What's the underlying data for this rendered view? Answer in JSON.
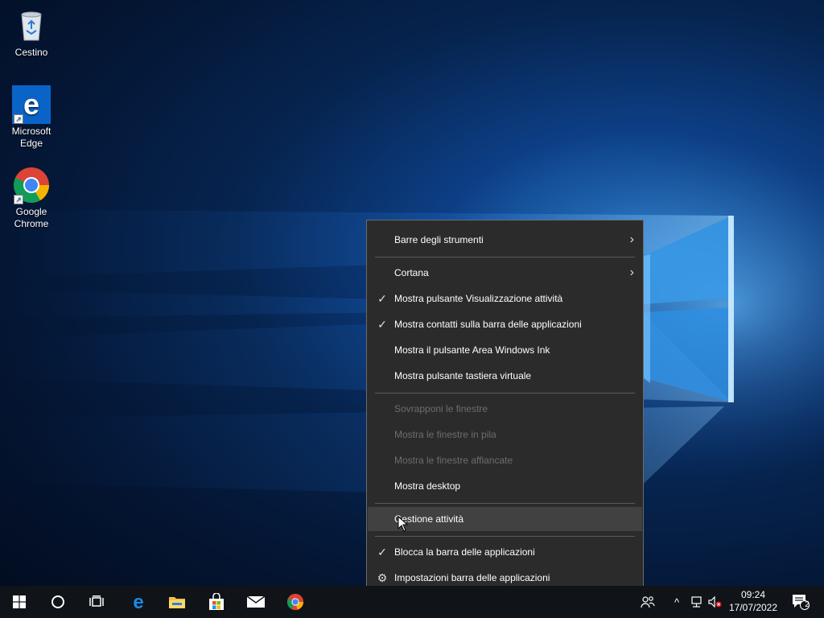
{
  "desktop": {
    "icons": [
      {
        "label_line1": "Cestino",
        "label_line2": ""
      },
      {
        "label_line1": "Microsoft",
        "label_line2": "Edge"
      },
      {
        "label_line1": "Google",
        "label_line2": "Chrome"
      }
    ]
  },
  "context_menu": {
    "items": [
      {
        "label": "Barre degli strumenti",
        "submenu": true,
        "checked": false,
        "disabled": false
      },
      {
        "label": "Cortana",
        "submenu": true,
        "checked": false,
        "disabled": false
      },
      {
        "label": "Mostra pulsante Visualizzazione attività",
        "checked": true,
        "disabled": false
      },
      {
        "label": "Mostra contatti sulla barra delle applicazioni",
        "checked": true,
        "disabled": false
      },
      {
        "label": "Mostra il pulsante Area Windows Ink",
        "checked": false,
        "disabled": false
      },
      {
        "label": "Mostra pulsante tastiera virtuale",
        "checked": false,
        "disabled": false
      },
      {
        "label": "Sovrapponi le finestre",
        "checked": false,
        "disabled": true
      },
      {
        "label": "Mostra le finestre in pila",
        "checked": false,
        "disabled": true
      },
      {
        "label": "Mostra le finestre affiancate",
        "checked": false,
        "disabled": true
      },
      {
        "label": "Mostra desktop",
        "checked": false,
        "disabled": false
      },
      {
        "label": "Gestione attività",
        "checked": false,
        "disabled": false,
        "hovered": true
      },
      {
        "label": "Blocca la barra delle applicazioni",
        "checked": true,
        "disabled": false
      },
      {
        "label": "Impostazioni barra delle applicazioni",
        "icon": "gear-icon",
        "disabled": false
      }
    ]
  },
  "taskbar": {
    "pinned": [
      "start-icon",
      "cortana-icon",
      "task-view-icon",
      "edge-icon",
      "file-explorer-icon",
      "store-icon",
      "mail-icon",
      "chrome-icon"
    ],
    "clock": {
      "time": "09:24",
      "date": "17/07/2022"
    },
    "notification_count": "2"
  },
  "colors": {
    "menu_bg": "#2b2b2b",
    "menu_hover": "#414141",
    "taskbar_bg": "#101418",
    "accent_blue": "#0a64c8"
  }
}
